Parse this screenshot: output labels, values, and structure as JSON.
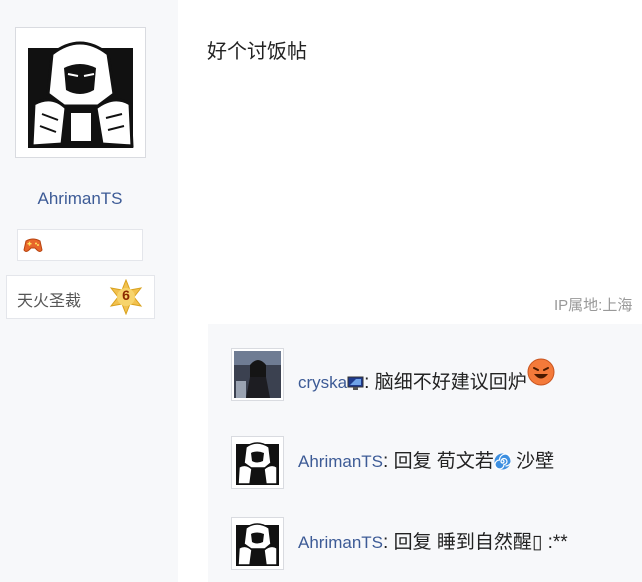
{
  "author": {
    "name": "AhrimanTS",
    "rank_title": "天火圣裁",
    "rank_level": "6",
    "avatar_icon": "masked-armored-figure-avatar",
    "badge_icon": "gamepad-icon"
  },
  "post": {
    "content": "好个讨饭帖",
    "ip_location": "IP属地:上海"
  },
  "replies": [
    {
      "author": "cryska",
      "separator": ":",
      "text": "脑细不好建议回炉",
      "avatar_icon": "photo-avatar",
      "name_icon": "monitor-icon",
      "emoji": "laughing-face-emoji"
    },
    {
      "author": "AhrimanTS",
      "separator": ":",
      "text_before": "回复 荀文若",
      "text_after": " 沙壁",
      "avatar_icon": "masked-armored-figure-avatar",
      "inline_icon": "spiral-icon"
    },
    {
      "author": "AhrimanTS",
      "separator": ":",
      "text": "回复 睡到自然醒▯ :**",
      "avatar_icon": "masked-armored-figure-avatar"
    }
  ],
  "colors": {
    "link": "#3d5b96",
    "sidebar_bg": "#f7f8fa",
    "reply_bg": "#f7f8fa",
    "ip_text": "#999999",
    "rank_star": "#f2c14e"
  }
}
